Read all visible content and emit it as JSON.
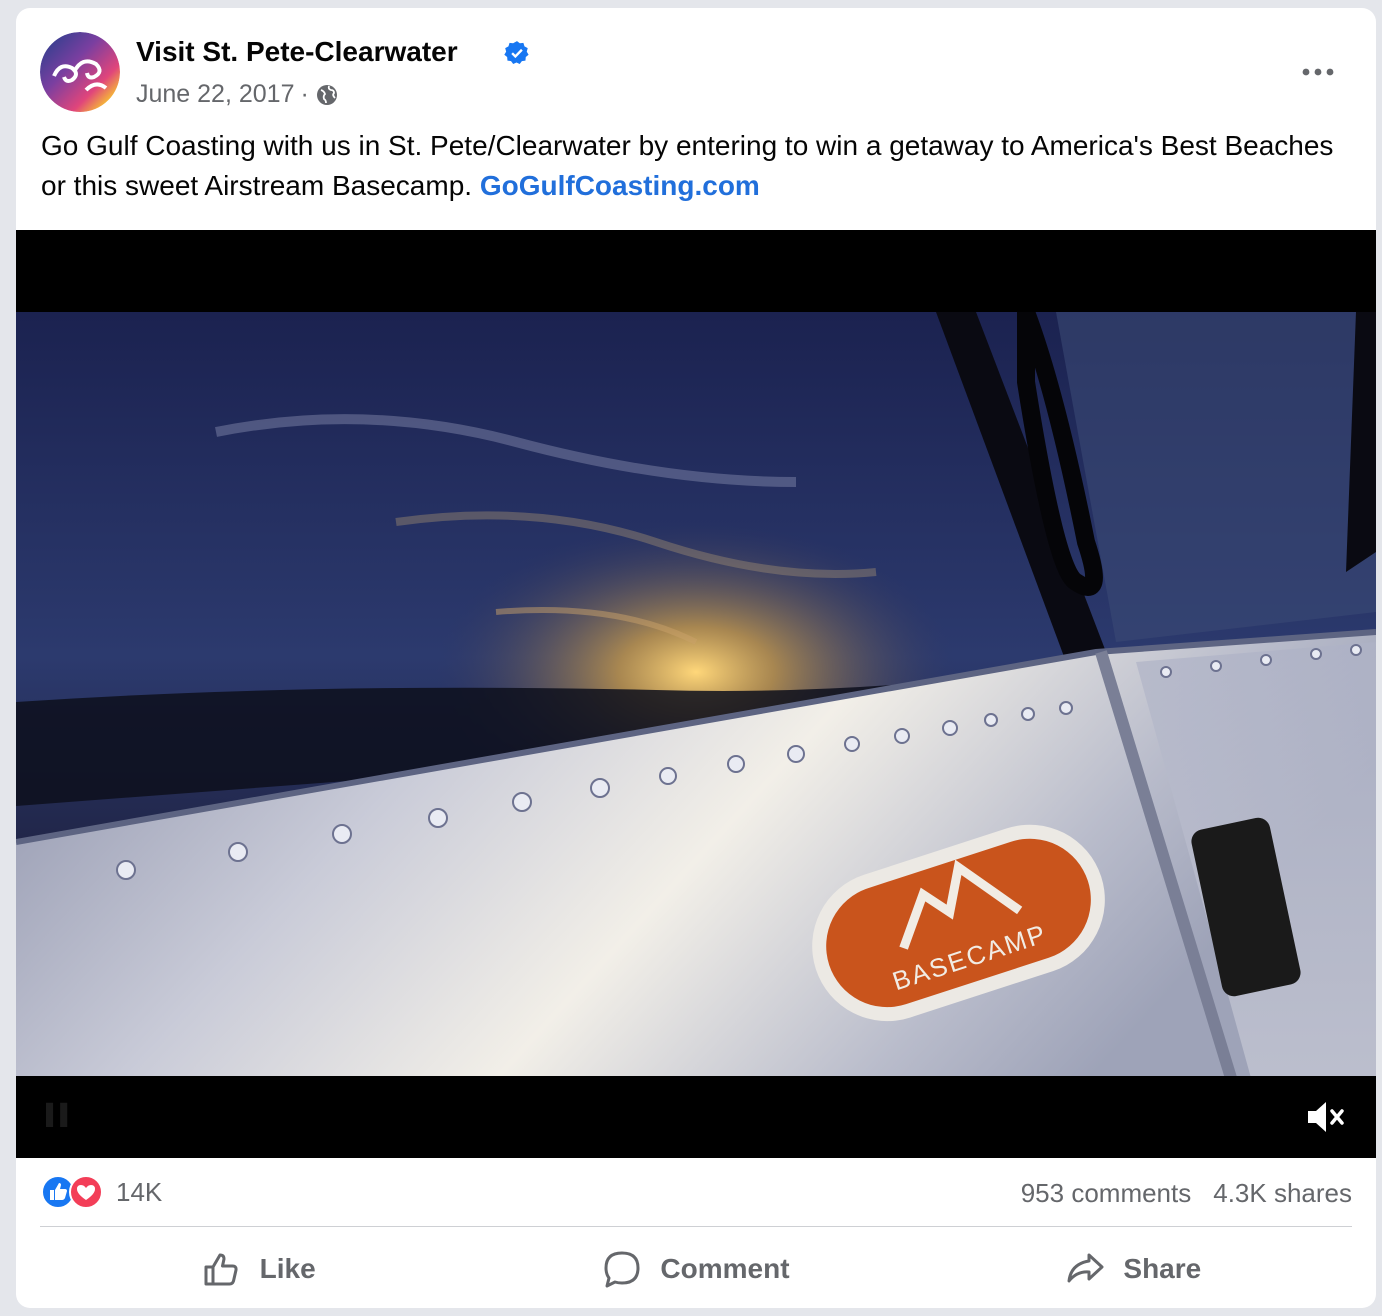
{
  "post": {
    "page_name": "Visit St. Pete-Clearwater",
    "date": "June 22, 2017",
    "separator": "·",
    "caption_text": "Go Gulf Coasting with us in St. Pete/Clearwater by entering to win a getaway to America's Best Beaches or this sweet Airstream Basecamp. ",
    "caption_link": "GoGulfCoasting.com"
  },
  "video": {
    "badge_text": "BASECAMP",
    "muted": true
  },
  "stats": {
    "reaction_count": "14K",
    "comments": "953 comments",
    "shares": "4.3K shares"
  },
  "actions": {
    "like": "Like",
    "comment": "Comment",
    "share": "Share"
  },
  "icons": {
    "verified": "verified-badge-icon",
    "audience": "globe-icon",
    "more": "more-options-icon",
    "mute": "muted-speaker-icon",
    "like_reaction": "like-reaction-icon",
    "love_reaction": "love-reaction-icon"
  },
  "colors": {
    "link": "#216fdb",
    "verified": "#1877f2",
    "muted_text": "#65676b"
  }
}
